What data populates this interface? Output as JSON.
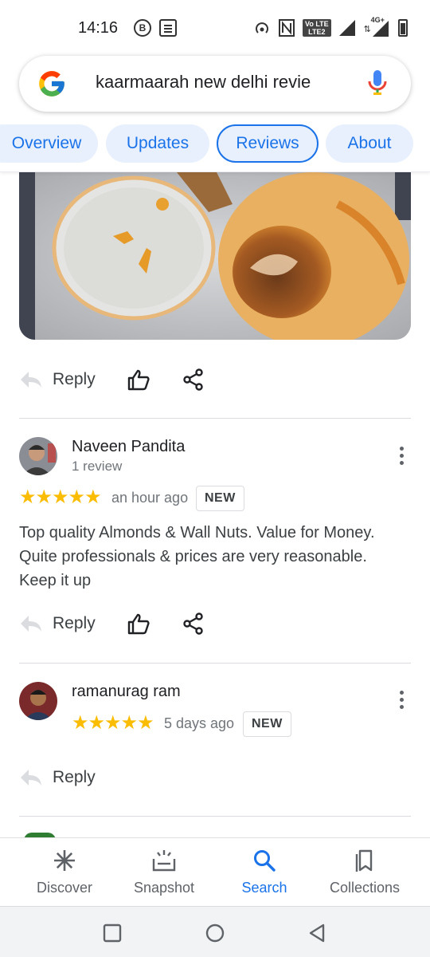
{
  "status_bar": {
    "time": "14:16",
    "b_icon_label": "B",
    "lte_label_top": "Vo LTE",
    "lte_label_bottom": "LTE2",
    "network_label": "4G+"
  },
  "search": {
    "query": "kaarmaarah new delhi revie"
  },
  "tabs": [
    {
      "label": "Overview"
    },
    {
      "label": "Updates"
    },
    {
      "label": "Reviews"
    },
    {
      "label": "About"
    }
  ],
  "reviews": [
    {
      "reply_label": "Reply"
    },
    {
      "name": "Naveen Pandita",
      "meta": "1 review",
      "stars": "★★★★★",
      "rating": 5,
      "time": "an hour ago",
      "badge": "NEW",
      "text": "Top quality Almonds & Wall Nuts. Value for Money. Quite professionals & prices are very reasonable. Keep it up",
      "reply_label": "Reply"
    },
    {
      "name": "ramanurag ram",
      "stars": "★★★★★",
      "rating": 5,
      "time": "5 days ago",
      "badge": "NEW",
      "reply_label": "Reply"
    }
  ],
  "bottom_nav": [
    {
      "label": "Discover",
      "icon": "asterisk-icon"
    },
    {
      "label": "Snapshot",
      "icon": "snapshot-icon"
    },
    {
      "label": "Search",
      "icon": "search-icon",
      "active": true
    },
    {
      "label": "Collections",
      "icon": "collections-icon"
    }
  ],
  "colors": {
    "accent": "#1a73e8",
    "star": "#fbbc04",
    "tab_bg": "#e8f0fe"
  }
}
